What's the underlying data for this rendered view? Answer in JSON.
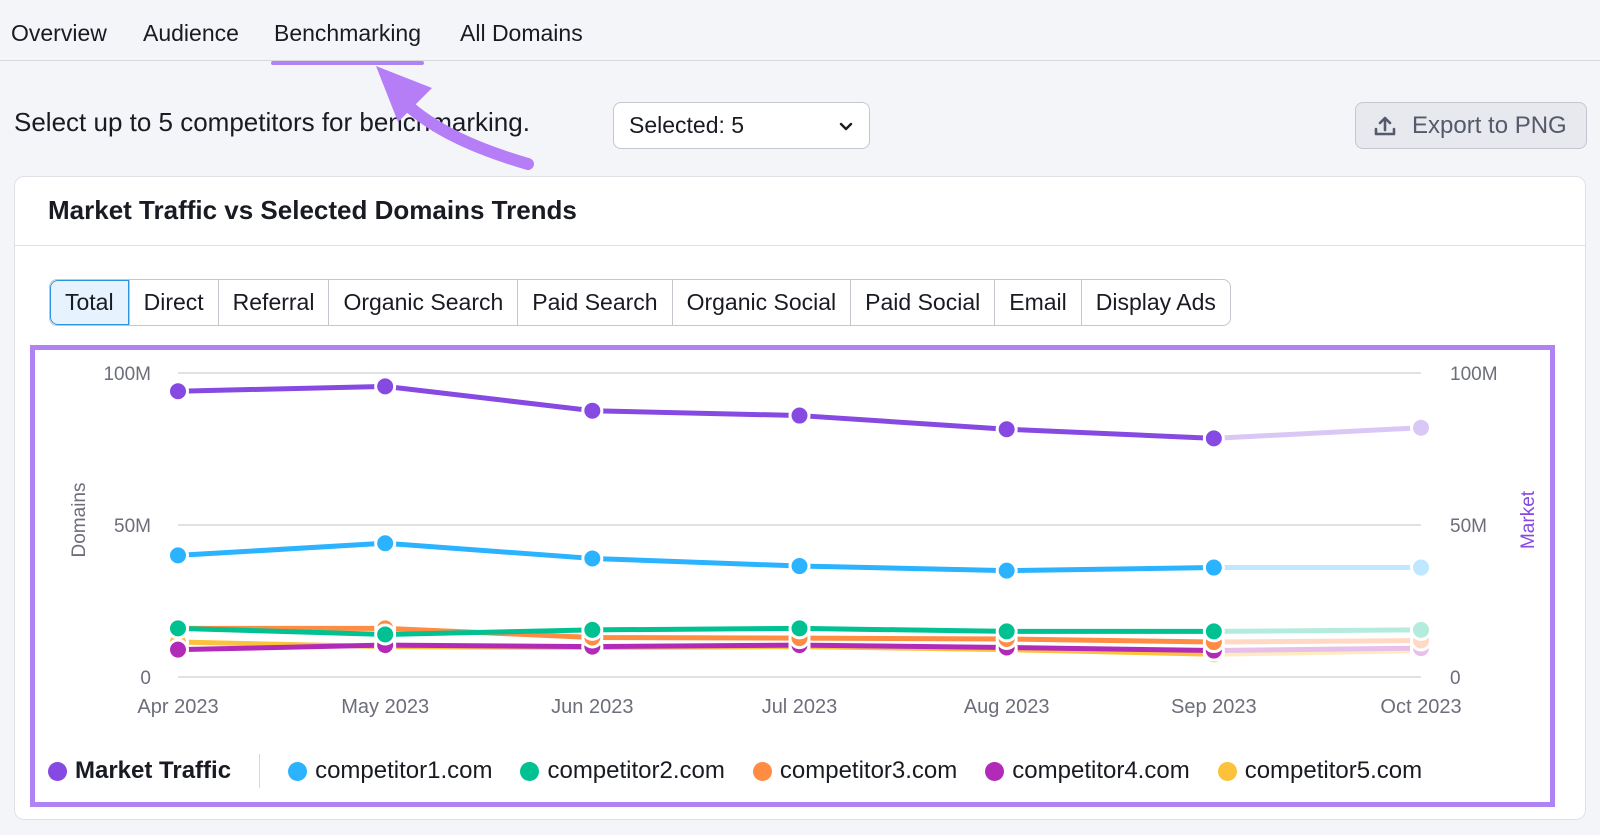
{
  "tabs": [
    {
      "label": "Overview",
      "active": false
    },
    {
      "label": "Audience",
      "active": false
    },
    {
      "label": "Benchmarking",
      "active": true
    },
    {
      "label": "All Domains",
      "active": false
    }
  ],
  "select_prompt": "Select up to 5 competitors for benchmarking.",
  "competitor_select": {
    "value": "Selected: 5",
    "icon": "chevron-down-icon"
  },
  "export_button": {
    "label": "Export to PNG",
    "icon": "upload-icon"
  },
  "card": {
    "title": "Market Traffic vs Selected Domains Trends",
    "segments": [
      {
        "label": "Total",
        "active": true
      },
      {
        "label": "Direct",
        "active": false
      },
      {
        "label": "Referral",
        "active": false
      },
      {
        "label": "Organic Search",
        "active": false
      },
      {
        "label": "Paid Search",
        "active": false
      },
      {
        "label": "Organic Social",
        "active": false
      },
      {
        "label": "Paid Social",
        "active": false
      },
      {
        "label": "Email",
        "active": false
      },
      {
        "label": "Display Ads",
        "active": false
      }
    ]
  },
  "annotation": {
    "highlight_color": "#b083f5",
    "arrow_color": "#b57ef7"
  },
  "chart_data": {
    "type": "line",
    "title": "Market Traffic vs Selected Domains Trends",
    "x": [
      "Apr 2023",
      "May 2023",
      "Jun 2023",
      "Jul 2023",
      "Aug 2023",
      "Sep 2023",
      "Oct 2023"
    ],
    "ylabel_left": "Domains",
    "ylabel_right": "Market",
    "y_ticks": [
      "0",
      "50M",
      "100M"
    ],
    "ylim": [
      0,
      100
    ],
    "y_units": "millions",
    "grid": true,
    "legend_position": "bottom",
    "projected_from_index": 5,
    "series": [
      {
        "name": "Market Traffic",
        "color": "#8649e1",
        "faded": "#d9c8f6",
        "axis": "right",
        "values": [
          94,
          95.6,
          87.6,
          86,
          81.5,
          78.5,
          82
        ]
      },
      {
        "name": "competitor1.com",
        "color": "#2bb3ff",
        "faded": "#bfe7ff",
        "axis": "left",
        "values": [
          40,
          44,
          39,
          36.5,
          35,
          36,
          36
        ]
      },
      {
        "name": "competitor2.com",
        "color": "#00c192",
        "faded": "#b3ecdc",
        "axis": "left",
        "values": [
          16,
          14,
          15.5,
          16,
          15,
          15,
          15.5
        ]
      },
      {
        "name": "competitor3.com",
        "color": "#ff8c43",
        "faded": "#ffd9c4",
        "axis": "left",
        "values": [
          16,
          16,
          13,
          12.8,
          12.5,
          11.5,
          12
        ]
      },
      {
        "name": "competitor4.com",
        "color": "#b22ab8",
        "faded": "#e8bfe9",
        "axis": "left",
        "values": [
          9,
          10.5,
          10,
          10.5,
          9.7,
          8.7,
          9.5
        ]
      },
      {
        "name": "competitor5.com",
        "color": "#fcc23b",
        "faded": "#feebc0",
        "axis": "left",
        "values": [
          11.5,
          10,
          9.7,
          10,
          9,
          7.5,
          8.7
        ]
      }
    ]
  }
}
